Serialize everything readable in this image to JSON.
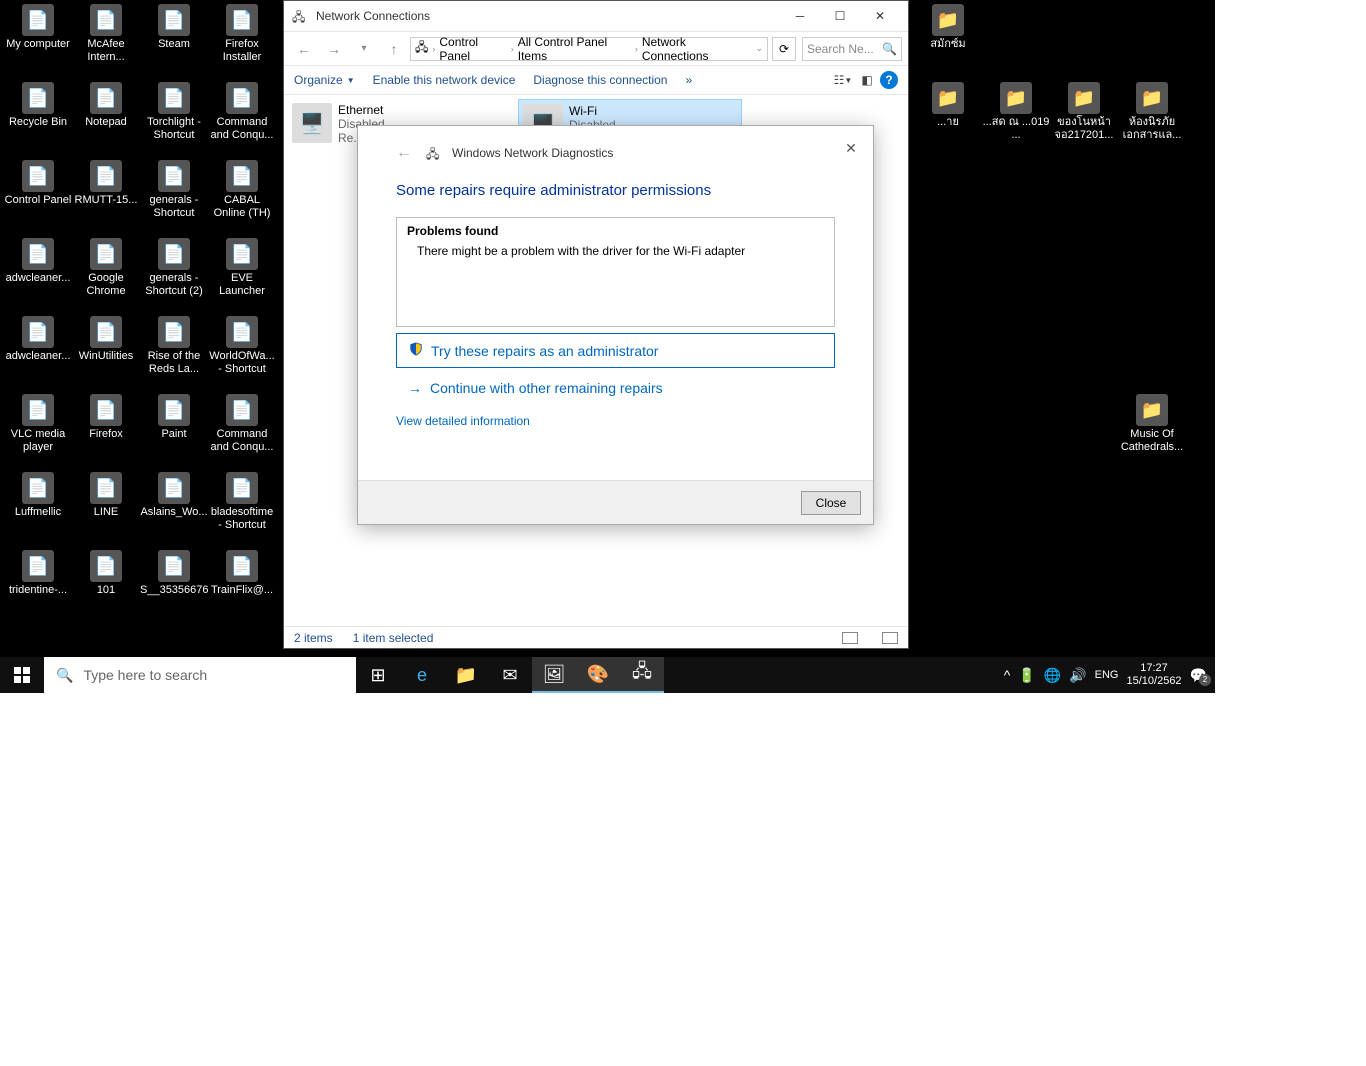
{
  "desktop_icons": [
    {
      "label": "My computer",
      "col": 0,
      "row": 0
    },
    {
      "label": "McAfee Intern...",
      "col": 1,
      "row": 0
    },
    {
      "label": "Steam",
      "col": 2,
      "row": 0
    },
    {
      "label": "Firefox Installer",
      "col": 3,
      "row": 0
    },
    {
      "label": "Recycle Bin",
      "col": 0,
      "row": 1
    },
    {
      "label": "Notepad",
      "col": 1,
      "row": 1
    },
    {
      "label": "Torchlight - Shortcut",
      "col": 2,
      "row": 1
    },
    {
      "label": "Command and Conqu...",
      "col": 3,
      "row": 1
    },
    {
      "label": "Control Panel",
      "col": 0,
      "row": 2
    },
    {
      "label": "RMUTT-15...",
      "col": 1,
      "row": 2
    },
    {
      "label": "generals - Shortcut",
      "col": 2,
      "row": 2
    },
    {
      "label": "CABAL Online (TH)",
      "col": 3,
      "row": 2
    },
    {
      "label": "adwcleaner...",
      "col": 0,
      "row": 3
    },
    {
      "label": "Google Chrome",
      "col": 1,
      "row": 3
    },
    {
      "label": "generals - Shortcut (2)",
      "col": 2,
      "row": 3
    },
    {
      "label": "EVE Launcher",
      "col": 3,
      "row": 3
    },
    {
      "label": "adwcleaner...",
      "col": 0,
      "row": 4
    },
    {
      "label": "WinUtilities",
      "col": 1,
      "row": 4
    },
    {
      "label": "Rise of the Reds La...",
      "col": 2,
      "row": 4
    },
    {
      "label": "WorldOfWa... - Shortcut",
      "col": 3,
      "row": 4
    },
    {
      "label": "VLC media player",
      "col": 0,
      "row": 5
    },
    {
      "label": "Firefox",
      "col": 1,
      "row": 5
    },
    {
      "label": "Paint",
      "col": 2,
      "row": 5
    },
    {
      "label": "Command and Conqu...",
      "col": 3,
      "row": 5
    },
    {
      "label": "Luffmellic",
      "col": 0,
      "row": 6
    },
    {
      "label": "LINE",
      "col": 1,
      "row": 6
    },
    {
      "label": "Aslains_Wo...",
      "col": 2,
      "row": 6
    },
    {
      "label": "bladesoftime - Shortcut",
      "col": 3,
      "row": 6
    },
    {
      "label": "tridentine-...",
      "col": 0,
      "row": 7
    },
    {
      "label": "101",
      "col": 1,
      "row": 7
    },
    {
      "label": "S__35356676",
      "col": 2,
      "row": 7
    },
    {
      "label": "TrainFlix@...",
      "col": 3,
      "row": 7
    }
  ],
  "desktop_icons_right": [
    {
      "label": "สมักซ์ม",
      "col": 0,
      "row": 0
    },
    {
      "label": "...าย",
      "col": 0,
      "row": 1
    },
    {
      "label": "...สด ณ ...019 ...",
      "col": 1,
      "row": 1
    },
    {
      "label": "ของโนหน้าจอ217201...",
      "col": 2,
      "row": 1
    },
    {
      "label": "ห้องนิรภัยเอกสารแล...",
      "col": 3,
      "row": 1
    },
    {
      "label": "Music Of Cathedrals...",
      "col": 3,
      "row": 5
    }
  ],
  "nc_window": {
    "title": "Network Connections",
    "breadcrumb": [
      "Control Panel",
      "All Control Panel Items",
      "Network Connections"
    ],
    "search_placeholder": "Search Ne...",
    "cmdbar": {
      "organize": "Organize",
      "enable": "Enable this network device",
      "diagnose": "Diagnose this connection"
    },
    "adapters": [
      {
        "name": "Ethernet",
        "status": "Disabled",
        "sub": "Re..."
      },
      {
        "name": "Wi-Fi",
        "status": "Disabled",
        "sub": ""
      }
    ],
    "status_items": "2 items",
    "status_sel": "1 item selected"
  },
  "dialog": {
    "title": "Windows Network Diagnostics",
    "heading": "Some repairs require administrator permissions",
    "problems_header": "Problems found",
    "problem_line": "There might be a problem with the driver for the Wi-Fi adapter",
    "repair_button": "Try these repairs as an administrator",
    "continue_link": "Continue with other remaining repairs",
    "detail_link": "View detailed information",
    "close": "Close"
  },
  "taskbar": {
    "search_placeholder": "Type here to search",
    "lang": "ENG",
    "time": "17:27",
    "date": "15/10/2562",
    "notif_count": "2"
  }
}
